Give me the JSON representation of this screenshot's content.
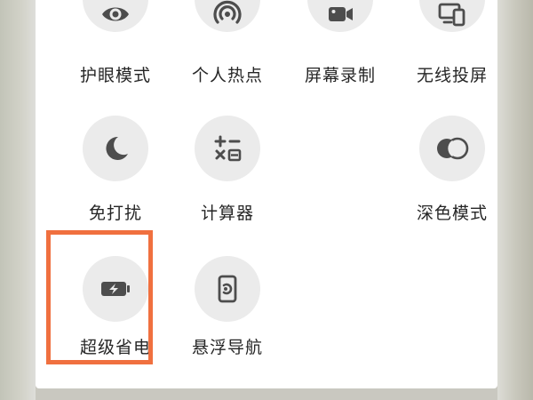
{
  "colors": {
    "icon": "#4d4d4d",
    "circle_bg": "#ebebeb",
    "highlight_border": "#f0703f",
    "label": "#262626"
  },
  "tiles": [
    {
      "label": "护眼模式",
      "icon": "eye-icon"
    },
    {
      "label": "个人热点",
      "icon": "hotspot-icon"
    },
    {
      "label": "屏幕录制",
      "icon": "video-camera-icon"
    },
    {
      "label": "无线投屏",
      "icon": "screen-cast-icon"
    },
    {
      "label": "免打扰",
      "icon": "moon-icon"
    },
    {
      "label": "计算器",
      "icon": "calculator-icon"
    },
    {
      "label": "深色模式",
      "icon": "dark-mode-icon"
    },
    {
      "label": "超级省电",
      "icon": "battery-saver-icon",
      "highlighted": true
    },
    {
      "label": "悬浮导航",
      "icon": "floating-nav-icon"
    }
  ]
}
